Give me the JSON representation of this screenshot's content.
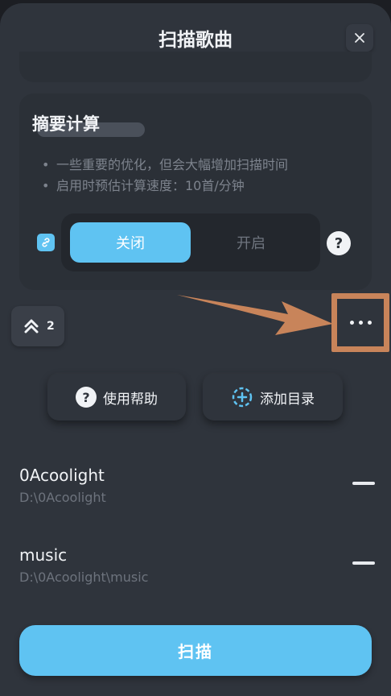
{
  "header": {
    "title": "扫描歌曲"
  },
  "summary_card": {
    "title": "摘要计算",
    "bullets": [
      "一些重要的优化，但会大幅增加扫描时间",
      "启用时预估计算速度：10首/分钟"
    ],
    "toggle": {
      "off_label": "关闭",
      "on_label": "开启",
      "selected": "关闭"
    },
    "help_glyph": "?"
  },
  "toolbar": {
    "collapse_count": "2"
  },
  "actions": {
    "help_label": "使用帮助",
    "add_folder_label": "添加目录"
  },
  "folders": [
    {
      "name": "0Acoolight",
      "path": "D:\\0Acoolight"
    },
    {
      "name": "music",
      "path": "D:\\0Acoolight\\music"
    }
  ],
  "scan_button": {
    "label": "扫描"
  },
  "colors": {
    "accent": "#5fc3f2",
    "highlight": "#c8845a",
    "background": "#2f343c"
  },
  "icons": [
    "close-icon",
    "link-icon",
    "help-icon",
    "double-chevron-up-icon",
    "more-icon",
    "add-folder-icon"
  ]
}
